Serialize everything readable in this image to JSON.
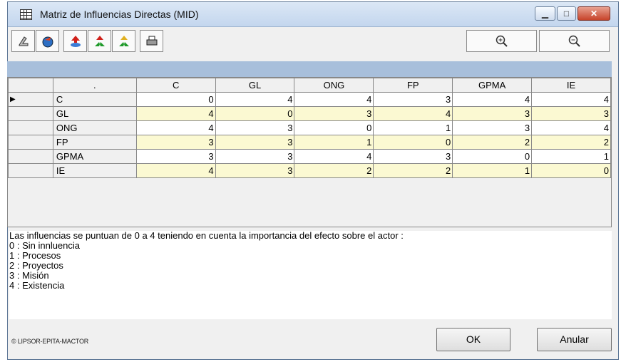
{
  "window": {
    "title": "Matriz de Influencias Directas (MID)"
  },
  "titlebar_buttons": {
    "minimize_icon": "minimize-icon",
    "maximize_icon": "maximize-icon",
    "close_icon": "close-icon"
  },
  "toolbar": {
    "buttons": [
      {
        "name": "print-preview-button",
        "icon": "hand-pointer-icon"
      },
      {
        "name": "copy-button",
        "icon": "globe-arrow-icon"
      },
      {
        "name": "upload-button",
        "icon": "red-arrow-up-icon"
      },
      {
        "name": "recycle-button",
        "icon": "green-recycle-icon"
      },
      {
        "name": "exchange-button",
        "icon": "yellow-recycle-icon"
      },
      {
        "name": "print-button",
        "icon": "printer-icon"
      }
    ],
    "zoom_in_icon": "zoom-in-icon",
    "zoom_out_icon": "zoom-out-icon"
  },
  "table": {
    "corner": ".",
    "columns": [
      "C",
      "GL",
      "ONG",
      "FP",
      "GPMA",
      "IE"
    ],
    "row_indicator": "▶",
    "rows": [
      {
        "name": "C",
        "values": [
          "0",
          "4",
          "4",
          "3",
          "4",
          "4"
        ]
      },
      {
        "name": "GL",
        "values": [
          "4",
          "0",
          "3",
          "4",
          "3",
          "3"
        ]
      },
      {
        "name": "ONG",
        "values": [
          "4",
          "3",
          "0",
          "1",
          "3",
          "4"
        ]
      },
      {
        "name": "FP",
        "values": [
          "3",
          "3",
          "1",
          "0",
          "2",
          "2"
        ]
      },
      {
        "name": "GPMA",
        "values": [
          "3",
          "3",
          "4",
          "3",
          "0",
          "1"
        ]
      },
      {
        "name": "IE",
        "values": [
          "4",
          "3",
          "2",
          "2",
          "1",
          "0"
        ]
      }
    ]
  },
  "description": {
    "intro": "Las influencias se puntuan de 0 a 4 teniendo en cuenta la importancia del efecto sobre el actor :",
    "levels": [
      "0 : Sin innluencia",
      "1 : Procesos",
      "2 : Proyectos",
      "3 : Misión",
      "4 : Existencia"
    ]
  },
  "footer": {
    "copyright": "© LIPSOR-EPITA-MACTOR",
    "ok_label": "OK",
    "cancel_label": "Anular"
  },
  "colors": {
    "highlight_row": "#fbf9d2",
    "band": "#a8bfdb"
  }
}
